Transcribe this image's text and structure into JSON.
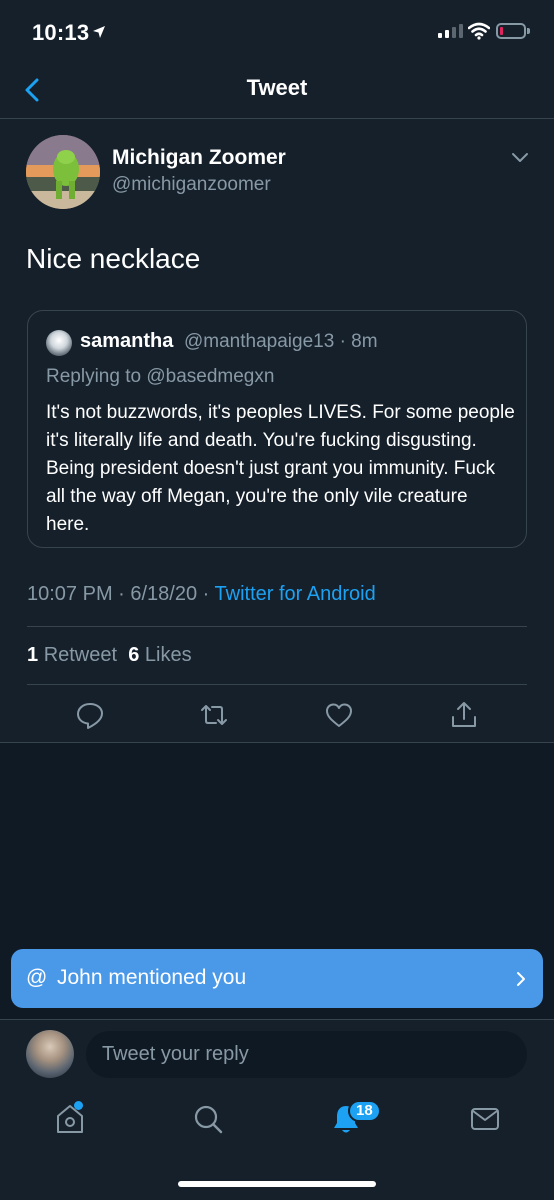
{
  "status_bar": {
    "time": "10:13"
  },
  "header": {
    "title": "Tweet"
  },
  "tweet": {
    "author_name": "Michigan Zoomer",
    "author_handle": "@michiganzoomer",
    "text": "Nice necklace",
    "timestamp": "10:07 PM · 6/18/20 · ",
    "source": "Twitter for Android",
    "retweets_count": "1",
    "retweets_label": "Retweet",
    "likes_count": "6",
    "likes_label": "Likes"
  },
  "quote": {
    "name": "samantha",
    "handle_time": "@manthapaige13 · 8m",
    "replying_to": "Replying to @basedmegxn",
    "text": "It's not buzzwords, it's peoples LIVES. For some people it's literally life and death. You're fucking disgusting. Being president doesn't just grant you immunity. Fuck all the way off Megan, you're the only vile creature here."
  },
  "toast": {
    "at": "@",
    "text": "John mentioned you"
  },
  "reply": {
    "placeholder": "Tweet your reply"
  },
  "tabbar": {
    "notifications_badge": "18"
  },
  "colors": {
    "background": "#15202b",
    "accent": "#1da1f2",
    "secondary_text": "#8899a6",
    "toast": "#4a99e9"
  },
  "icons": [
    "location-arrow-icon",
    "signal-icon",
    "wifi-icon",
    "battery-icon",
    "back-chevron-icon",
    "chevron-down-icon",
    "reply-icon",
    "retweet-icon",
    "like-icon",
    "share-icon",
    "chevron-right-icon",
    "home-icon",
    "search-icon",
    "notifications-icon",
    "messages-icon"
  ]
}
